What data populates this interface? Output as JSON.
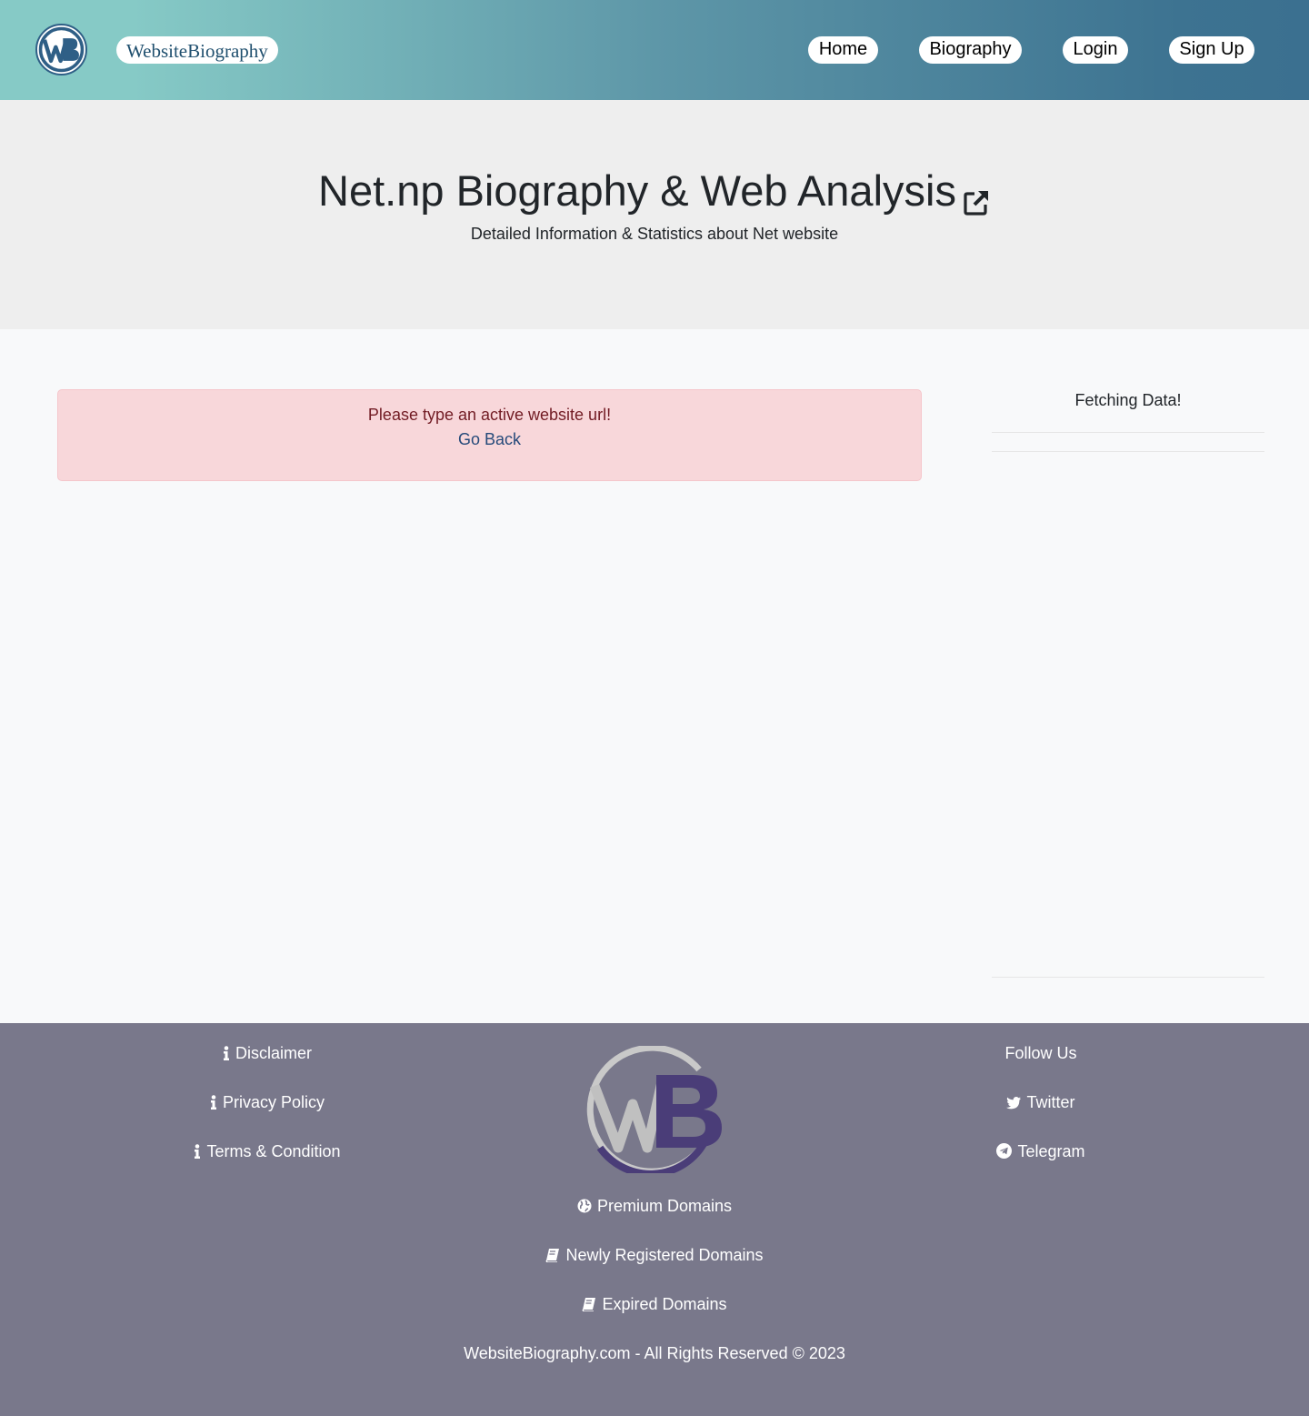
{
  "brand": {
    "name": "WebsiteBiography",
    "logo_icon": "wb-logo-icon"
  },
  "nav": {
    "home": "Home",
    "biography": "Biography",
    "login": "Login",
    "signup": "Sign Up"
  },
  "hero": {
    "title": "Net.np Biography & Web Analysis",
    "subtitle": "Detailed Information & Statistics about Net website",
    "title_icon": "external-link-icon"
  },
  "alert": {
    "message": "Please type an active website url!",
    "back_link": "Go Back"
  },
  "sidebar": {
    "title": "Fetching Data!"
  },
  "footer": {
    "left_links": [
      "Disclaimer",
      "Privacy Policy",
      "Terms & Condition"
    ],
    "center_links": [
      "Premium Domains",
      "Newly Registered Domains",
      "Expired Domains"
    ],
    "follow_title": "Follow Us",
    "social": [
      "Twitter",
      "Telegram"
    ],
    "copyright": "WebsiteBiography.com - All Rights Reserved © 2023"
  },
  "colors": {
    "header_gradient_start": "#86cac6",
    "header_gradient_end": "#3b7090",
    "footer_bg": "#79788b",
    "alert_bg": "#f8d7da",
    "alert_text": "#721c24"
  }
}
